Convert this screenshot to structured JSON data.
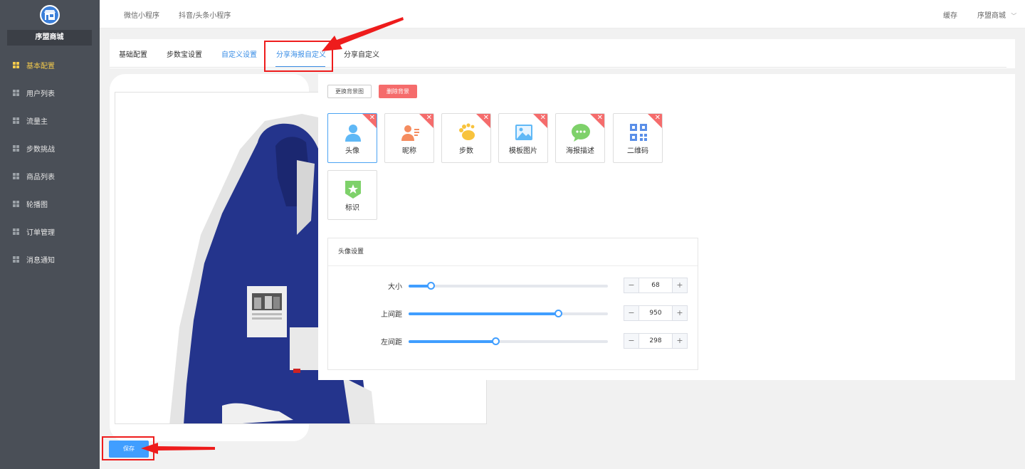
{
  "sidebar": {
    "brand": "序盟商城",
    "items": [
      {
        "label": "基本配置",
        "active": true
      },
      {
        "label": "用户列表"
      },
      {
        "label": "流量主"
      },
      {
        "label": "步数挑战"
      },
      {
        "label": "商品列表"
      },
      {
        "label": "轮播图"
      },
      {
        "label": "订单管理"
      },
      {
        "label": "消息通知"
      }
    ]
  },
  "header": {
    "links": [
      "微信小程序",
      "抖音/头条小程序"
    ],
    "cache": "缓存",
    "user": "序盟商城",
    "user_caret": "﹀"
  },
  "tabs": [
    {
      "label": "基础配置"
    },
    {
      "label": "步数宝设置"
    },
    {
      "label": "自定义设置"
    },
    {
      "label": "分享海报自定义",
      "active": true
    },
    {
      "label": "分享自定义"
    }
  ],
  "actions": {
    "change_bg": "更换背景图",
    "delete_bg": "删除背景"
  },
  "elements": [
    {
      "label": "头像",
      "icon": "avatar-icon",
      "color": "#5fb8f6",
      "selected": true
    },
    {
      "label": "昵称",
      "icon": "nickname-icon",
      "color": "#f58c5f"
    },
    {
      "label": "步数",
      "icon": "footprint-icon",
      "color": "#f8c33d"
    },
    {
      "label": "模板图片",
      "icon": "image-icon",
      "color": "#5fb8f6"
    },
    {
      "label": "海报描述",
      "icon": "chat-bubble-icon",
      "color": "#7ed16a"
    },
    {
      "label": "二维码",
      "icon": "qrcode-icon",
      "color": "#5a8fe8"
    },
    {
      "label": "标识",
      "icon": "badge-star-icon",
      "color": "#7ed16a"
    }
  ],
  "settings": {
    "title": "头像设置",
    "rows": [
      {
        "label": "大小",
        "value": "68",
        "fraction": 0.11
      },
      {
        "label": "上间距",
        "value": "950",
        "fraction": 0.75
      },
      {
        "label": "左间距",
        "value": "298",
        "fraction": 0.435
      }
    ],
    "minus": "−",
    "plus": "+"
  },
  "save": "保存",
  "colors": {
    "sidebar_bg": "#4a4f57",
    "active_menu": "#f2c94c",
    "primary": "#409eff",
    "danger": "#f56c6c",
    "annotation": "#ee1c1c"
  }
}
